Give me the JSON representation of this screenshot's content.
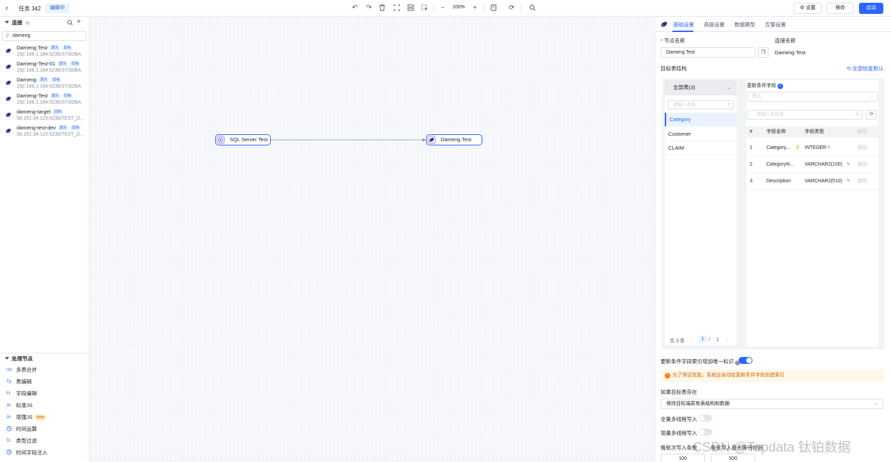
{
  "topbar": {
    "title": "任务 342",
    "badge": "编辑中",
    "zoom": "100%",
    "settings_label": "设置",
    "save_label": "保存",
    "start_label": "启动"
  },
  "left": {
    "connections_header": "连接",
    "connections_count": "6",
    "search_value": "dameng",
    "connections": [
      {
        "name": "Dameng Test",
        "tags": [
          "源头",
          "目标"
        ],
        "addr": "192.168.1.184:5236/SYSDBA"
      },
      {
        "name": "Dameng-Test-01",
        "tags": [
          "源头",
          "目标"
        ],
        "addr": "192.168.1.184:5236/SYSDBA"
      },
      {
        "name": "Dameng",
        "tags": [
          "源头",
          "目标"
        ],
        "addr": "192.168.1.184:5236/SYSDBA"
      },
      {
        "name": "Dameng-Test",
        "tags": [
          "源头",
          "目标"
        ],
        "addr": "192.168.1.184:5236/SYSDBA"
      },
      {
        "name": "dameng-target",
        "tags": [
          "目标"
        ],
        "addr": "58.251.34.123:5236/TEST_D..."
      },
      {
        "name": "dameng-test-dev",
        "tags": [
          "源头",
          "目标"
        ],
        "addr": "58.251.34.123:5236/TEST_D..."
      }
    ],
    "processing_header": "处理节点",
    "processing": [
      {
        "icon": "Un",
        "label": "多表合并"
      },
      {
        "icon": "Tp",
        "label": "表编辑"
      },
      {
        "icon": "Fr",
        "label": "字段编辑"
      },
      {
        "icon": "Js",
        "label": "标准JS"
      },
      {
        "icon": "Js",
        "label": "增强JS",
        "badge": "beta"
      },
      {
        "icon": "clock",
        "label": "时间运算"
      },
      {
        "icon": "Tc",
        "label": "类型过滤"
      },
      {
        "icon": "clock",
        "label": "时间字段注入"
      }
    ]
  },
  "canvas": {
    "source_node": "SQL Server Test",
    "target_node": "Dameng Test"
  },
  "panel": {
    "tabs": [
      "基础设置",
      "高级设置",
      "数据模型",
      "告警设置"
    ],
    "node_name_label": "节点名称",
    "node_name_value": "Dameng Test",
    "conn_name_label": "连接名称",
    "conn_name_value": "Dameng Test",
    "target_struct_label": "目标表结构",
    "restore_all": "全部恢复默认",
    "all_tables": "全部表(3)",
    "table_search_placeholder": "请输入表名",
    "tables": [
      "Category",
      "Customer",
      "CLAIM"
    ],
    "pager_total": "共 3 条",
    "pager_page": "1",
    "pager_sep": "/",
    "pager_pages": "1",
    "update_field_label": "更新条件字段",
    "update_field_placeholder": "默认",
    "field_search_placeholder": "请输入字段名",
    "columns": {
      "idx": "#",
      "name": "字段名称",
      "type": "字段类型",
      "action": "撤销"
    },
    "fields": [
      {
        "idx": "1",
        "name": "Category...",
        "type": "INTEGER",
        "action": "撤销"
      },
      {
        "idx": "2",
        "name": "CategoryN...",
        "type": "VARCHAR2(100)",
        "action": "撤销"
      },
      {
        "idx": "3",
        "name": "Description",
        "type": "VARCHAR2(510)",
        "action": "撤销"
      }
    ],
    "unique_index_label": "更新条件字段索引增加唯一标识",
    "warning": "为了保证性能，系统会自动给更新条件字段创建索引",
    "if_exists_label": "如果目标表存在",
    "if_exists_value": "保持目标端原有表结构和数据",
    "full_multi_label": "全量多线程写入",
    "incr_multi_label": "增量多线程写入",
    "batch_label": "每批次写入条数",
    "batch_label2": "每批写入最大等待时间",
    "batch_value": "100",
    "wait_value": "500"
  },
  "watermark": "CSDN @Tapdata 钛铂数据",
  "colors": {
    "accent": "#2c65ff",
    "warning": "#ff7d00"
  }
}
